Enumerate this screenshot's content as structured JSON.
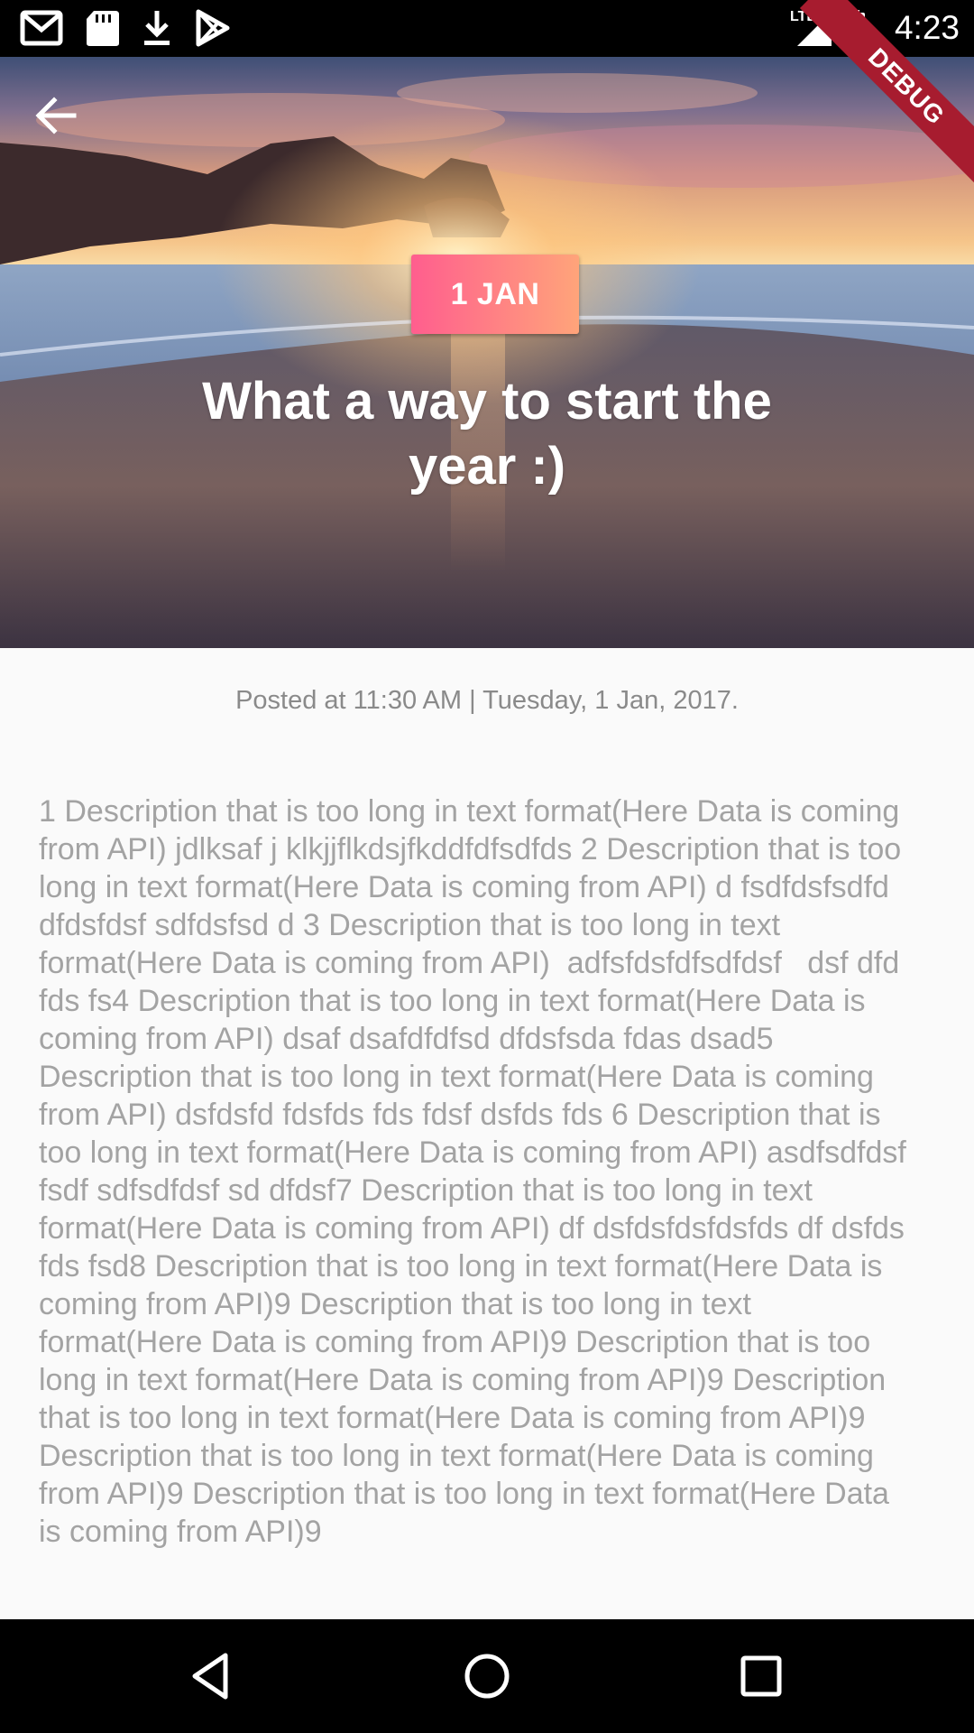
{
  "status_bar": {
    "time": "4:23",
    "network": "LTE",
    "icons": [
      "gmail-icon",
      "sd-card-icon",
      "download-icon",
      "play-store-icon",
      "signal-icon",
      "battery-charging-icon"
    ]
  },
  "debug_banner": "DEBUG",
  "hero": {
    "date_badge": "1 JAN",
    "title": "What a way to start the year :)",
    "badge_colors": [
      "#ff5e8e",
      "#ffa47a"
    ]
  },
  "post": {
    "posted_text": "Posted at 11:30 AM | Tuesday, 1 Jan, 2017.",
    "description": "1 Description that is too long in text format(Here Data is coming from API) jdlksaf j klkjjflkdsjfkddfdfsdfds 2 Description that is too long in text format(Here Data is coming from API) d fsdfdsfsdfd dfdsfdsf sdfdsfsd d 3 Description that is too long in text format(Here Data is coming from API)  adfsfdsfdfsdfdsf   dsf dfd fds fs4 Description that is too long in text format(Here Data is coming from API) dsaf dsafdfdfsd dfdsfsda fdas dsad5 Description that is too long in text format(Here Data is coming from API) dsfdsfd fdsfds fds fdsf dsfds fds 6 Description that is too long in text format(Here Data is coming from API) asdfsdfdsf fsdf sdfsdfdsf sd dfdsf7 Description that is too long in text format(Here Data is coming from API) df dsfdsfdsfdsfds df dsfds fds fsd8 Description that is too long in text format(Here Data is coming from API)9 Description that is too long in text format(Here Data is coming from API)9 Description that is too long in text format(Here Data is coming from API)9 Description that is too long in text format(Here Data is coming from API)9 Description that is too long in text format(Here Data is coming from API)9 Description that is too long in text format(Here Data is coming from API)9"
  },
  "nav_bar": {
    "icons": [
      "back-triangle-icon",
      "home-circle-icon",
      "recents-square-icon"
    ]
  }
}
